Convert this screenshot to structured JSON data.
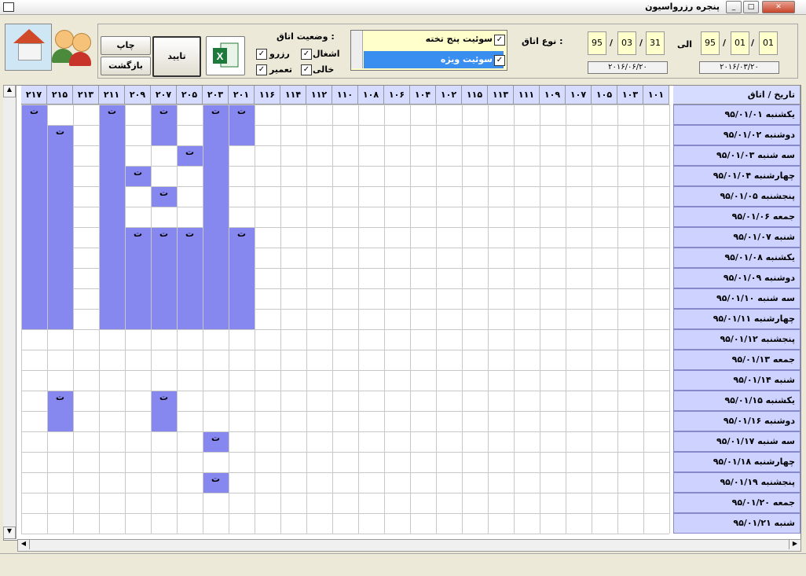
{
  "window": {
    "title": "پنجره رزرواسیون"
  },
  "toolbar": {
    "print_label": "چاپ",
    "back_label": "بازگشت",
    "confirm_label": "تایید",
    "status_title": "وضعیت اتاق :",
    "status_opts": [
      {
        "label": "اشغال",
        "checked": true
      },
      {
        "label": "رزرو",
        "checked": true
      },
      {
        "label": "خالی",
        "checked": true
      },
      {
        "label": "تعمیر",
        "checked": true
      }
    ],
    "room_type_title": "نوع اتاق :",
    "room_types": [
      {
        "label": "سوئیت پنج تخته",
        "checked": true,
        "selected": false
      },
      {
        "label": "سوئیت ویژه",
        "checked": true,
        "selected": true
      }
    ],
    "from_date": {
      "day": "01",
      "month": "01",
      "year": "95",
      "gregorian": "۲۰۱۶/۰۳/۲۰"
    },
    "to_label": "الی",
    "to_date": {
      "day": "31",
      "month": "03",
      "year": "95",
      "gregorian": "۲۰۱۶/۰۶/۲۰"
    }
  },
  "grid": {
    "corner_label": "تاریخ / اتاق",
    "rooms": [
      "۲۱۷",
      "۲۱۵",
      "۲۱۳",
      "۲۱۱",
      "۲۰۹",
      "۲۰۷",
      "۲۰۵",
      "۲۰۳",
      "۲۰۱",
      "۱۱۶",
      "۱۱۴",
      "۱۱۲",
      "۱۱۰",
      "۱۰۸",
      "۱۰۶",
      "۱۰۴",
      "۱۰۲",
      "۱۱۵",
      "۱۱۳",
      "۱۱۱",
      "۱۰۹",
      "۱۰۷",
      "۱۰۵",
      "۱۰۳",
      "۱۰۱"
    ],
    "dates": [
      "۹۵/۰۱/۰۱ یکشنبه",
      "۹۵/۰۱/۰۲ دوشنبه",
      "۹۵/۰۱/۰۳ سه شنبه",
      "۹۵/۰۱/۰۴ چهارشنبه",
      "۹۵/۰۱/۰۵ پنجشنبه",
      "۹۵/۰۱/۰۶ جمعه",
      "۹۵/۰۱/۰۷ شنبه",
      "۹۵/۰۱/۰۸ یکشنبه",
      "۹۵/۰۱/۰۹ دوشنبه",
      "۹۵/۰۱/۱۰ سه شنبه",
      "۹۵/۰۱/۱۱ چهارشنبه",
      "۹۵/۰۱/۱۲ پنجشنبه",
      "۹۵/۰۱/۱۳ جمعه",
      "۹۵/۰۱/۱۴ شنبه",
      "۹۵/۰۱/۱۵ یکشنبه",
      "۹۵/۰۱/۱۶ دوشنبه",
      "۹۵/۰۱/۱۷ سه شنبه",
      "۹۵/۰۱/۱۸ چهارشنبه",
      "۹۵/۰۱/۱۹ پنجشنبه",
      "۹۵/۰۱/۲۰ جمعه",
      "۹۵/۰۱/۲۱ شنبه"
    ],
    "occupied_color": "#8787f0",
    "mark_text": "ت",
    "bookings": [
      {
        "room": 0,
        "from": 0,
        "to": 10,
        "mark": true
      },
      {
        "room": 1,
        "from": 1,
        "to": 10,
        "mark": true
      },
      {
        "room": 3,
        "from": 0,
        "to": 10,
        "mark": true
      },
      {
        "room": 4,
        "from": 3,
        "to": 3,
        "mark": true
      },
      {
        "room": 4,
        "from": 6,
        "to": 10,
        "mark": true
      },
      {
        "room": 5,
        "from": 0,
        "to": 1,
        "mark": true
      },
      {
        "room": 5,
        "from": 4,
        "to": 4,
        "mark": true
      },
      {
        "room": 5,
        "from": 6,
        "to": 10,
        "mark": true
      },
      {
        "room": 6,
        "from": 2,
        "to": 2,
        "mark": true
      },
      {
        "room": 6,
        "from": 6,
        "to": 10,
        "mark": true
      },
      {
        "room": 7,
        "from": 0,
        "to": 10,
        "mark": true
      },
      {
        "room": 8,
        "from": 0,
        "to": 1,
        "mark": true
      },
      {
        "room": 8,
        "from": 6,
        "to": 10,
        "mark": true
      },
      {
        "room": 1,
        "from": 14,
        "to": 15,
        "mark": true
      },
      {
        "room": 5,
        "from": 14,
        "to": 15,
        "mark": true
      },
      {
        "room": 7,
        "from": 16,
        "to": 16,
        "mark": true
      },
      {
        "room": 7,
        "from": 18,
        "to": 18,
        "mark": true
      }
    ],
    "extra_marks": [
      {
        "room": 0,
        "row": 0
      },
      {
        "room": 0,
        "row": 4
      },
      {
        "room": 3,
        "row": 0
      },
      {
        "room": 5,
        "row": 0
      },
      {
        "room": 5,
        "row": 6
      },
      {
        "room": 6,
        "row": 6
      },
      {
        "room": 7,
        "row": 0
      },
      {
        "room": 8,
        "row": 0
      },
      {
        "room": 8,
        "row": 6
      },
      {
        "room": 4,
        "row": 6
      },
      {
        "room": 1,
        "row": 1
      }
    ]
  }
}
